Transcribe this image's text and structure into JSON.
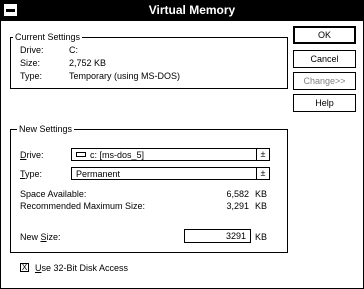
{
  "window": {
    "title": "Virtual Memory"
  },
  "current_settings": {
    "group_label": "Current Settings",
    "drive_label": "Drive:",
    "drive_value": "C:",
    "size_label": "Size:",
    "size_value": "2,752 KB",
    "type_label": "Type:",
    "type_value": "Temporary (using MS-DOS)"
  },
  "buttons": {
    "ok": "OK",
    "cancel": "Cancel",
    "change": "Change>>",
    "help": "Help"
  },
  "new_settings": {
    "group_label": "New Settings",
    "drive_label_ul": "D",
    "drive_label_rest": "rive:",
    "drive_value": "c: [ms-dos_5]",
    "type_label_ul": "T",
    "type_label_rest": "ype:",
    "type_value": "Permanent",
    "space_available_label": "Space Available:",
    "space_available_value": "6,582",
    "recommended_max_label": "Recommended Maximum Size:",
    "recommended_max_value": "3,291",
    "kb_unit": "KB",
    "new_size_label_pre": "New ",
    "new_size_label_ul": "S",
    "new_size_label_post": "ize:",
    "new_size_value": "3291",
    "new_size_unit": "KB"
  },
  "disk_access": {
    "checked_mark": "X",
    "label_ul": "U",
    "label_rest": "se 32-Bit Disk Access"
  },
  "icons": {
    "system_menu": "system-menu-icon",
    "drive": "hard-drive-icon",
    "dropdown": "dropdown-arrow-icon"
  }
}
